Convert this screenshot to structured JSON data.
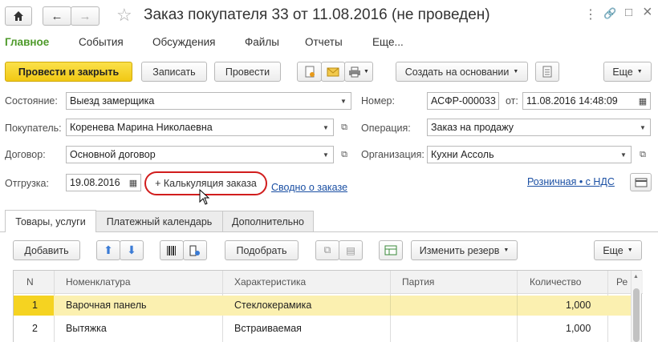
{
  "window": {
    "title": "Заказ покупателя 33 от 11.08.2016 (не проведен)",
    "controls": [
      "⋮",
      "🔗",
      "□",
      "×"
    ]
  },
  "nav_tabs": [
    "Главное",
    "События",
    "Обсуждения",
    "Файлы",
    "Отчеты",
    "Еще..."
  ],
  "toolbar": {
    "post_close": "Провести и закрыть",
    "write": "Записать",
    "post": "Провести",
    "create_based": "Создать на основании",
    "more": "Еще"
  },
  "form": {
    "state_label": "Состояние:",
    "state_value": "Выезд замерщика",
    "buyer_label": "Покупатель:",
    "buyer_value": "Коренева Марина Николаевна",
    "contract_label": "Договор:",
    "contract_value": "Основной договор",
    "shipment_label": "Отгрузка:",
    "shipment_value": "19.08.2016",
    "calc_link": "+ Калькуляция заказа",
    "summary_link": "Сводно о заказе",
    "number_label": "Номер:",
    "number_value": "АСФР-000033",
    "date_from_label": "от:",
    "date_value": "11.08.2016 14:48:09",
    "operation_label": "Операция:",
    "operation_value": "Заказ на продажу",
    "org_label": "Организация:",
    "org_value": "Кухни Ассоль",
    "price_link": "Розничная • с НДС"
  },
  "tabs": [
    "Товары, услуги",
    "Платежный календарь",
    "Дополнительно"
  ],
  "table_toolbar": {
    "add": "Добавить",
    "pick": "Подобрать",
    "change_reserve": "Изменить резерв",
    "more": "Еще"
  },
  "table": {
    "headers": [
      "N",
      "Номенклатура",
      "Характеристика",
      "Партия",
      "Количество",
      "Ре"
    ],
    "rows": [
      {
        "n": "1",
        "item": "Варочная панель",
        "char": "Стеклокерамика",
        "batch": "",
        "qty": "1,000"
      },
      {
        "n": "2",
        "item": "Вытяжка",
        "char": "Встраиваемая",
        "batch": "",
        "qty": "1,000"
      }
    ]
  },
  "colors": {
    "accent_green": "#4e9a2a",
    "primary_yellow": "#f5d321",
    "selected_row": "#fbf0b0",
    "link_blue": "#1a4fa3",
    "highlight_red": "#d11d1d"
  }
}
